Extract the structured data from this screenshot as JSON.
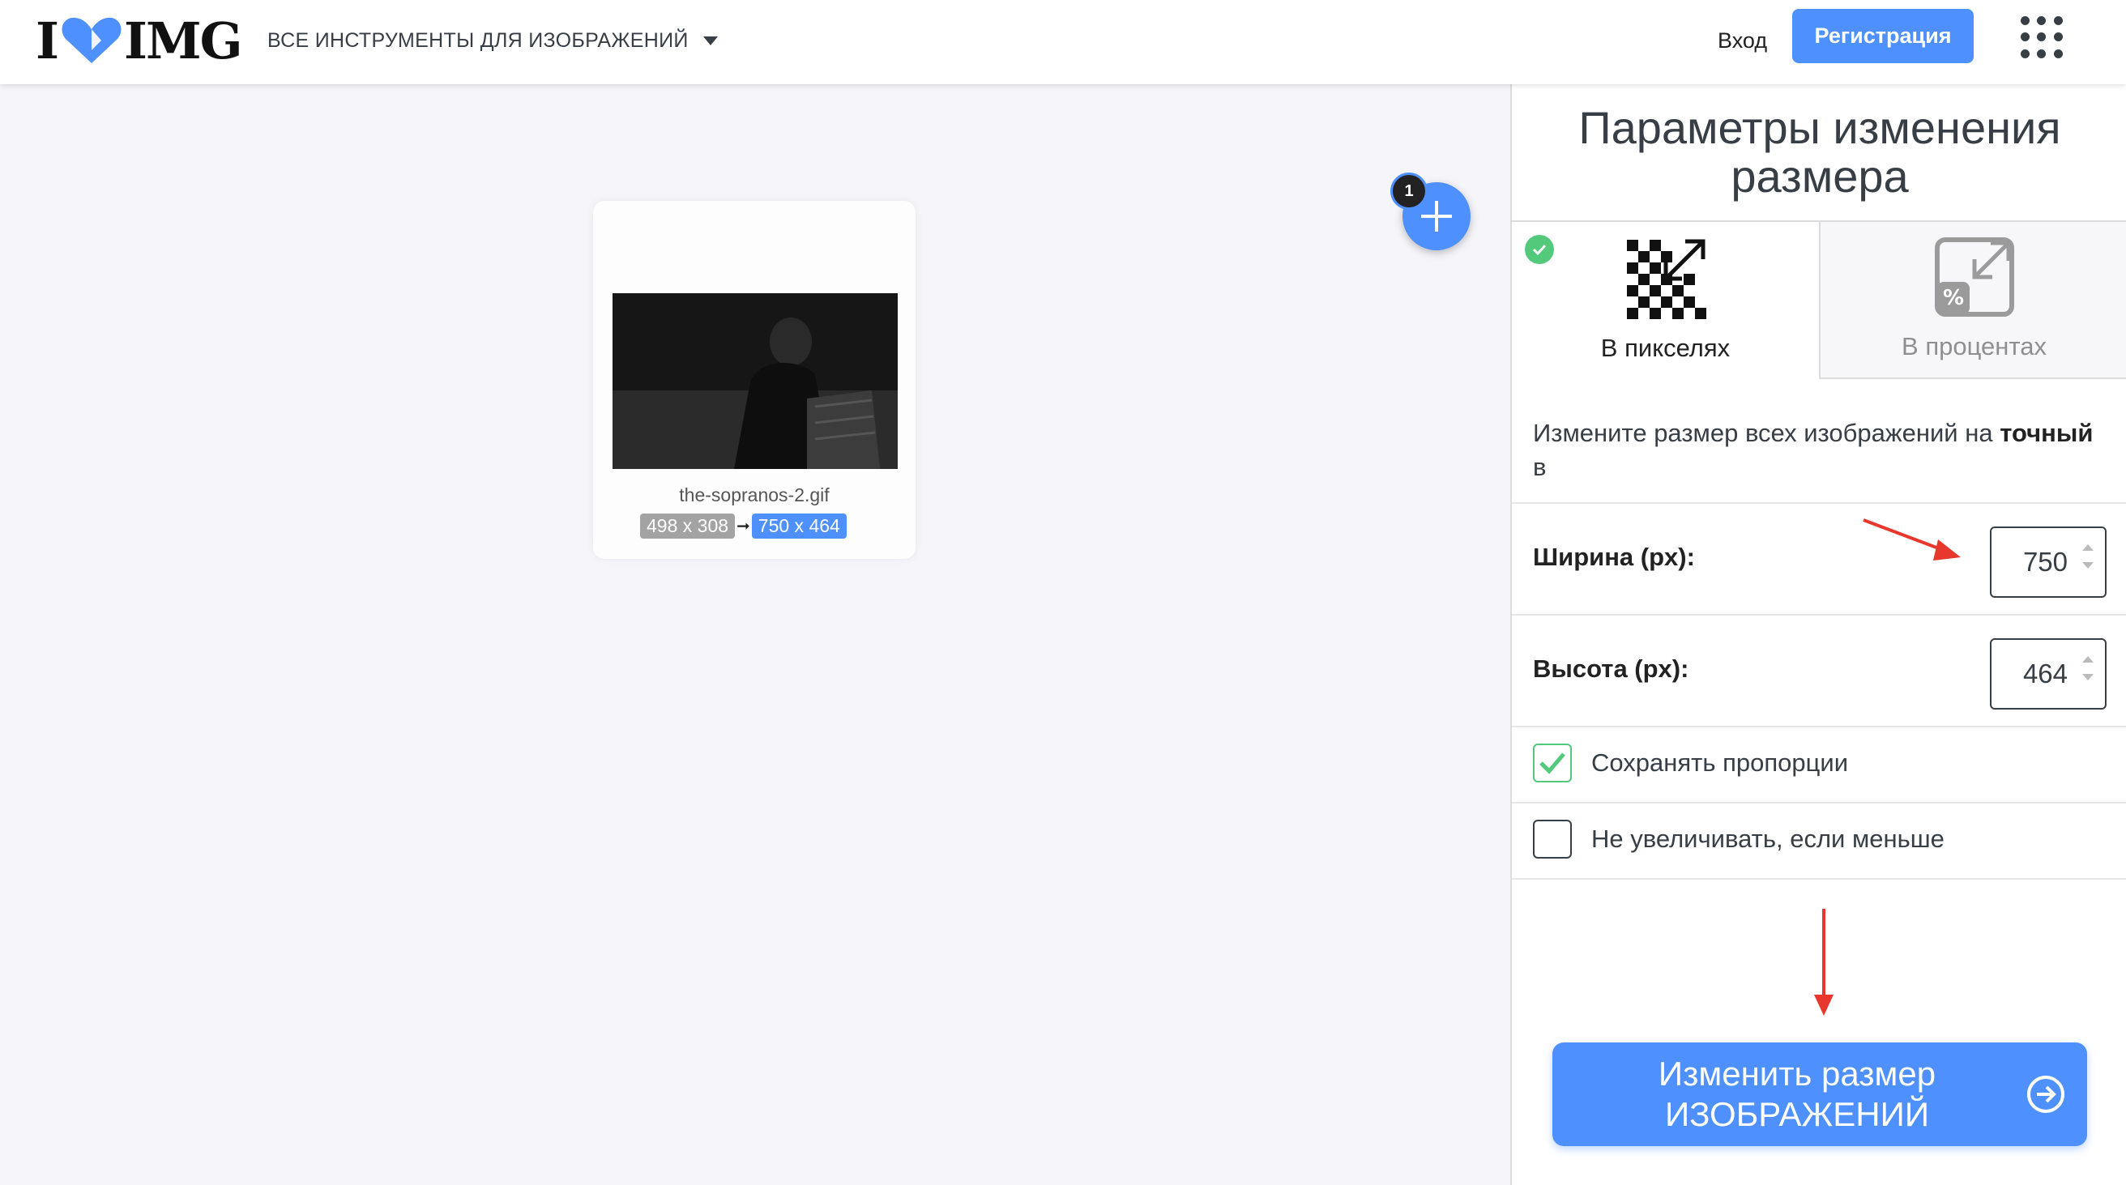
{
  "header": {
    "logo_left": "I",
    "logo_right": "IMG",
    "tools_menu_label": "ВСЕ ИНСТРУМЕНТЫ ДЛЯ ИЗОБРАЖЕНИЙ",
    "login_label": "Вход",
    "signup_label": "Регистрация"
  },
  "workspace": {
    "file": {
      "name": "the-sopranos-2.gif",
      "original_size": "498 x 308",
      "new_size": "750 x 464"
    },
    "file_count": "1"
  },
  "sidebar": {
    "title": "Параметры изменения размера",
    "tabs": [
      {
        "label": "В пикселях",
        "active": true
      },
      {
        "label": "В процентах",
        "active": false
      }
    ],
    "description_prefix": "Измените размер всех изображений на ",
    "description_bold": "точный",
    "description_suffix": " в",
    "width_label": "Ширина (px):",
    "width_value": "750",
    "height_label": "Высота (px):",
    "height_value": "464",
    "keep_ratio_label": "Сохранять пропорции",
    "keep_ratio_checked": true,
    "no_enlarge_label": "Не увеличивать, если меньше",
    "no_enlarge_checked": false,
    "submit_line1": "Изменить размер",
    "submit_line2": "ИЗОБРАЖЕНИЙ"
  },
  "colors": {
    "accent": "#4d90fe",
    "check_green": "#52c97b",
    "annotation_red": "#e8372c",
    "text_dark": "#383e45"
  }
}
